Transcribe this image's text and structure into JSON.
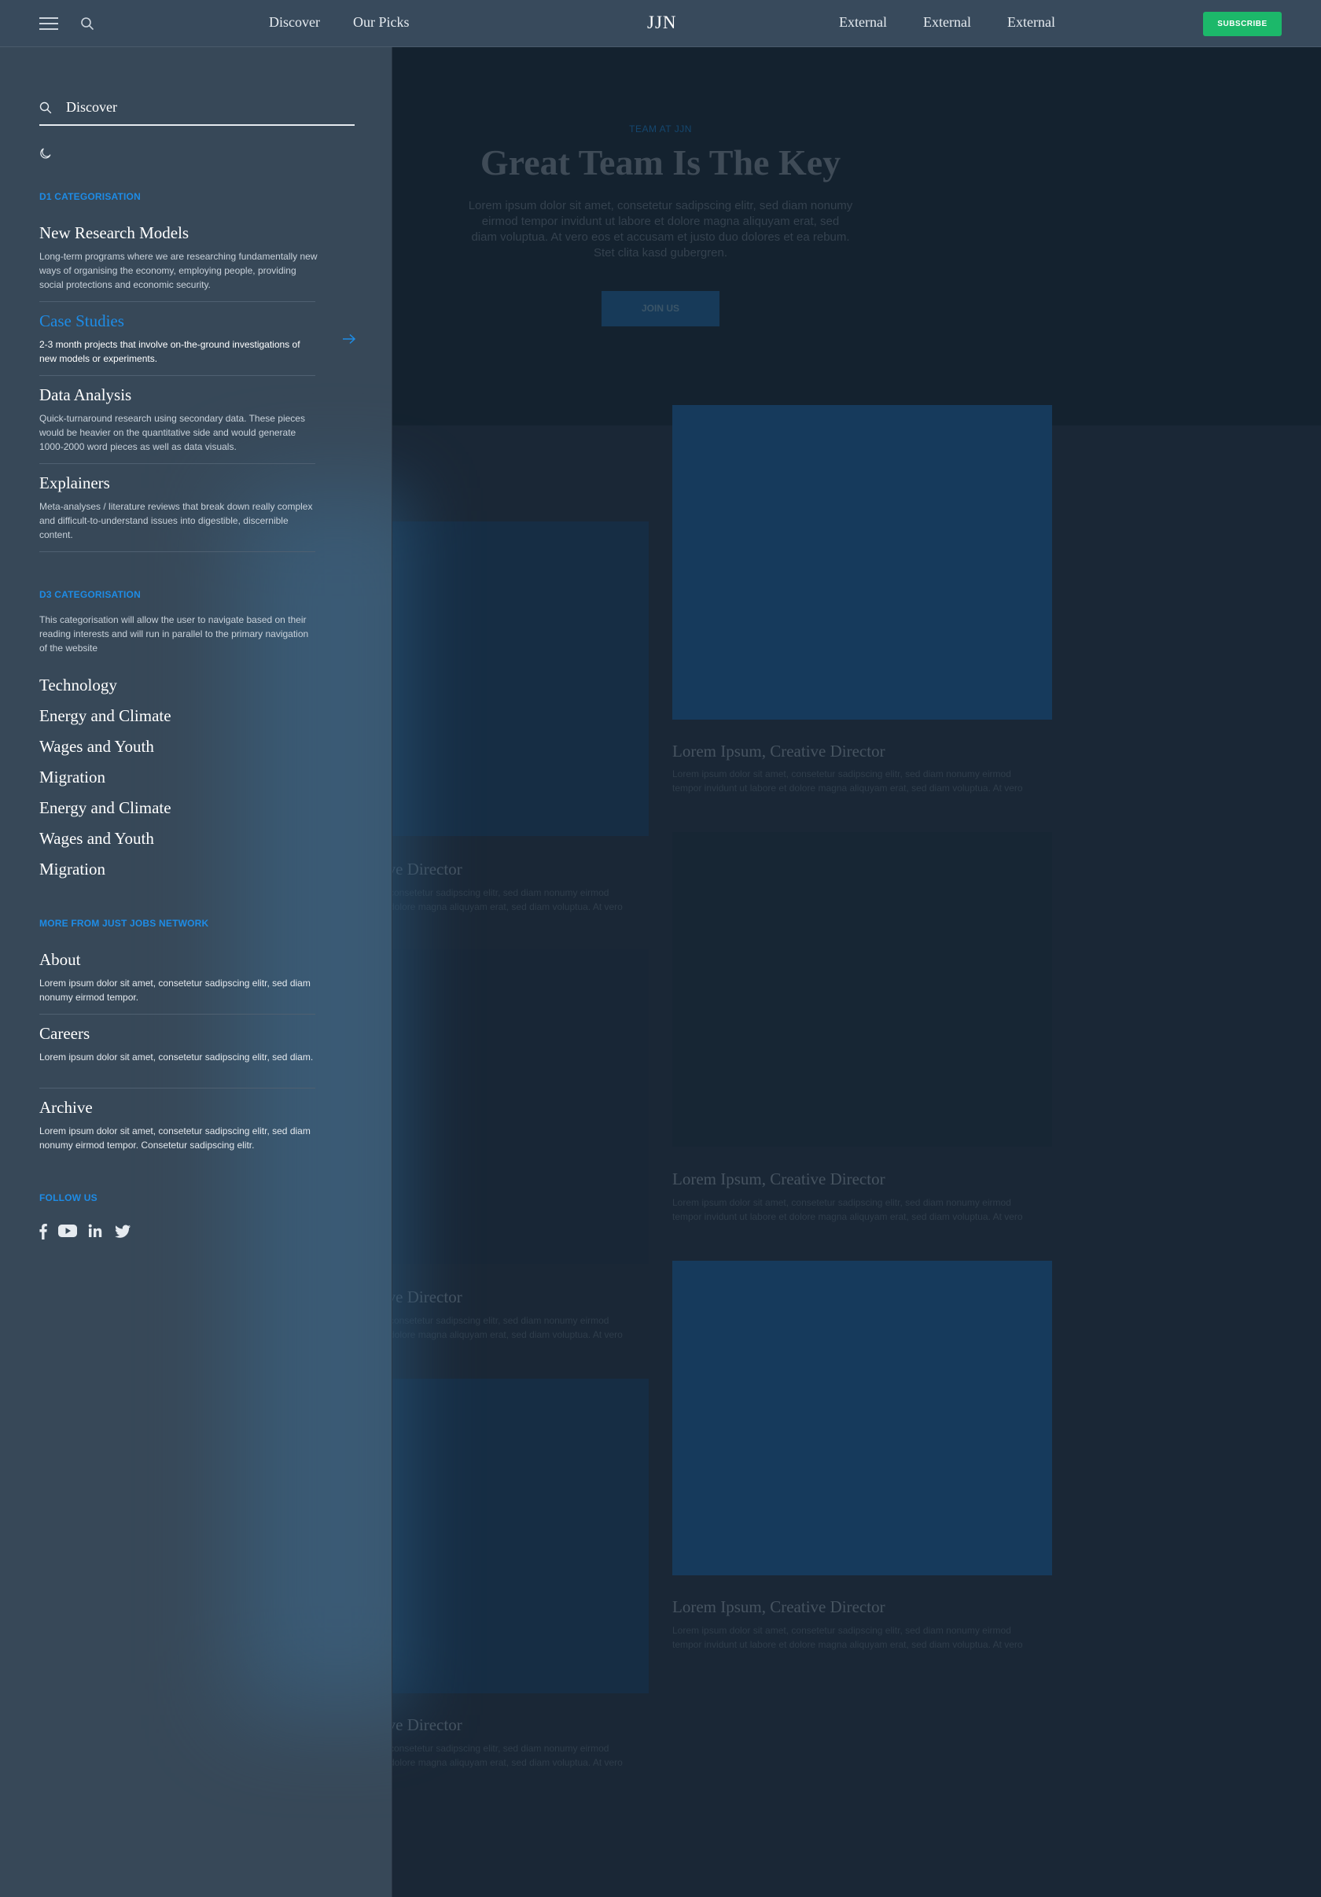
{
  "header": {
    "nav": [
      "Discover",
      "Our Picks"
    ],
    "logo": "JJN",
    "external": [
      "External",
      "External",
      "External"
    ],
    "subscribe": "SUBSCRIBE"
  },
  "hero": {
    "eyebrow": "TEAM AT JJN",
    "title": "Great Team Is The Key",
    "description": "Lorem ipsum dolor sit amet, consetetur sadipscing elitr, sed diam nonumy eirmod tempor invidunt ut labore et dolore magna aliquyam erat, sed diam voluptua. At vero eos et accusam et justo duo dolores et ea rebum. Stet clita kasd gubergren.",
    "cta": "JOIN US"
  },
  "cards": {
    "right_title": "Lorem Ipsum, Creative Director",
    "left_title_visible": "tive Director",
    "desc_line1": "Lorem ipsum dolor sit amet, consetetur sadipscing elitr, sed diam nonumy eirmod",
    "desc_line2": "tempor invidunt ut labore et dolore magna aliquyam erat, sed diam voluptua. At vero",
    "left_desc_line1": "consetetur sadipscing elitr, sed diam nonumy eirmod",
    "left_desc_line2": "dolore magna aliquyam erat, sed diam voluptua. At vero"
  },
  "drawer": {
    "search_value": "Discover",
    "d1_heading": "D1 CATEGORISATION",
    "d1_items": [
      {
        "title": "New Research Models",
        "desc": "Long-term programs where we are researching fundamentally new ways of organising the economy, employing people, providing social protections and economic security."
      },
      {
        "title": "Case Studies",
        "desc": "2-3 month projects that involve on-the-ground investigations of new models or experiments."
      },
      {
        "title": "Data Analysis",
        "desc": "Quick-turnaround research using secondary data. These pieces would be heavier on the quantitative side and would generate 1000-2000 word pieces as well as data visuals."
      },
      {
        "title": "Explainers",
        "desc": "Meta-analyses / literature reviews that break down really complex and difficult-to-understand issues into digestible, discernible content."
      }
    ],
    "d3_heading": "D3 CATEGORISATION",
    "d3_desc": "This categorisation will allow the user to navigate based on their reading interests and will run in parallel to the primary navigation of the website",
    "topics": [
      "Technology",
      "Energy and Climate",
      "Wages and Youth",
      "Migration",
      "Energy and Climate",
      "Wages and Youth",
      "Migration"
    ],
    "more_heading": "MORE FROM JUST JOBS NETWORK",
    "more_items": [
      {
        "title": "About",
        "desc": "Lorem ipsum dolor sit amet, consetetur sadipscing elitr, sed diam nonumy eirmod tempor."
      },
      {
        "title": "Careers",
        "desc": "Lorem ipsum dolor sit amet, consetetur sadipscing elitr, sed diam."
      },
      {
        "title": "Archive",
        "desc": "Lorem ipsum dolor sit amet, consetetur sadipscing elitr, sed diam nonumy eirmod tempor. Consetetur sadipscing elitr."
      }
    ],
    "follow_heading": "FOLLOW US",
    "social": [
      "facebook-icon",
      "youtube-icon",
      "linkedin-icon",
      "twitter-icon"
    ]
  },
  "colors": {
    "accent": "#1e8ce6",
    "subscribe": "#1cb86a",
    "drawer_bg": "#374858",
    "page_bg": "#1a2736"
  }
}
